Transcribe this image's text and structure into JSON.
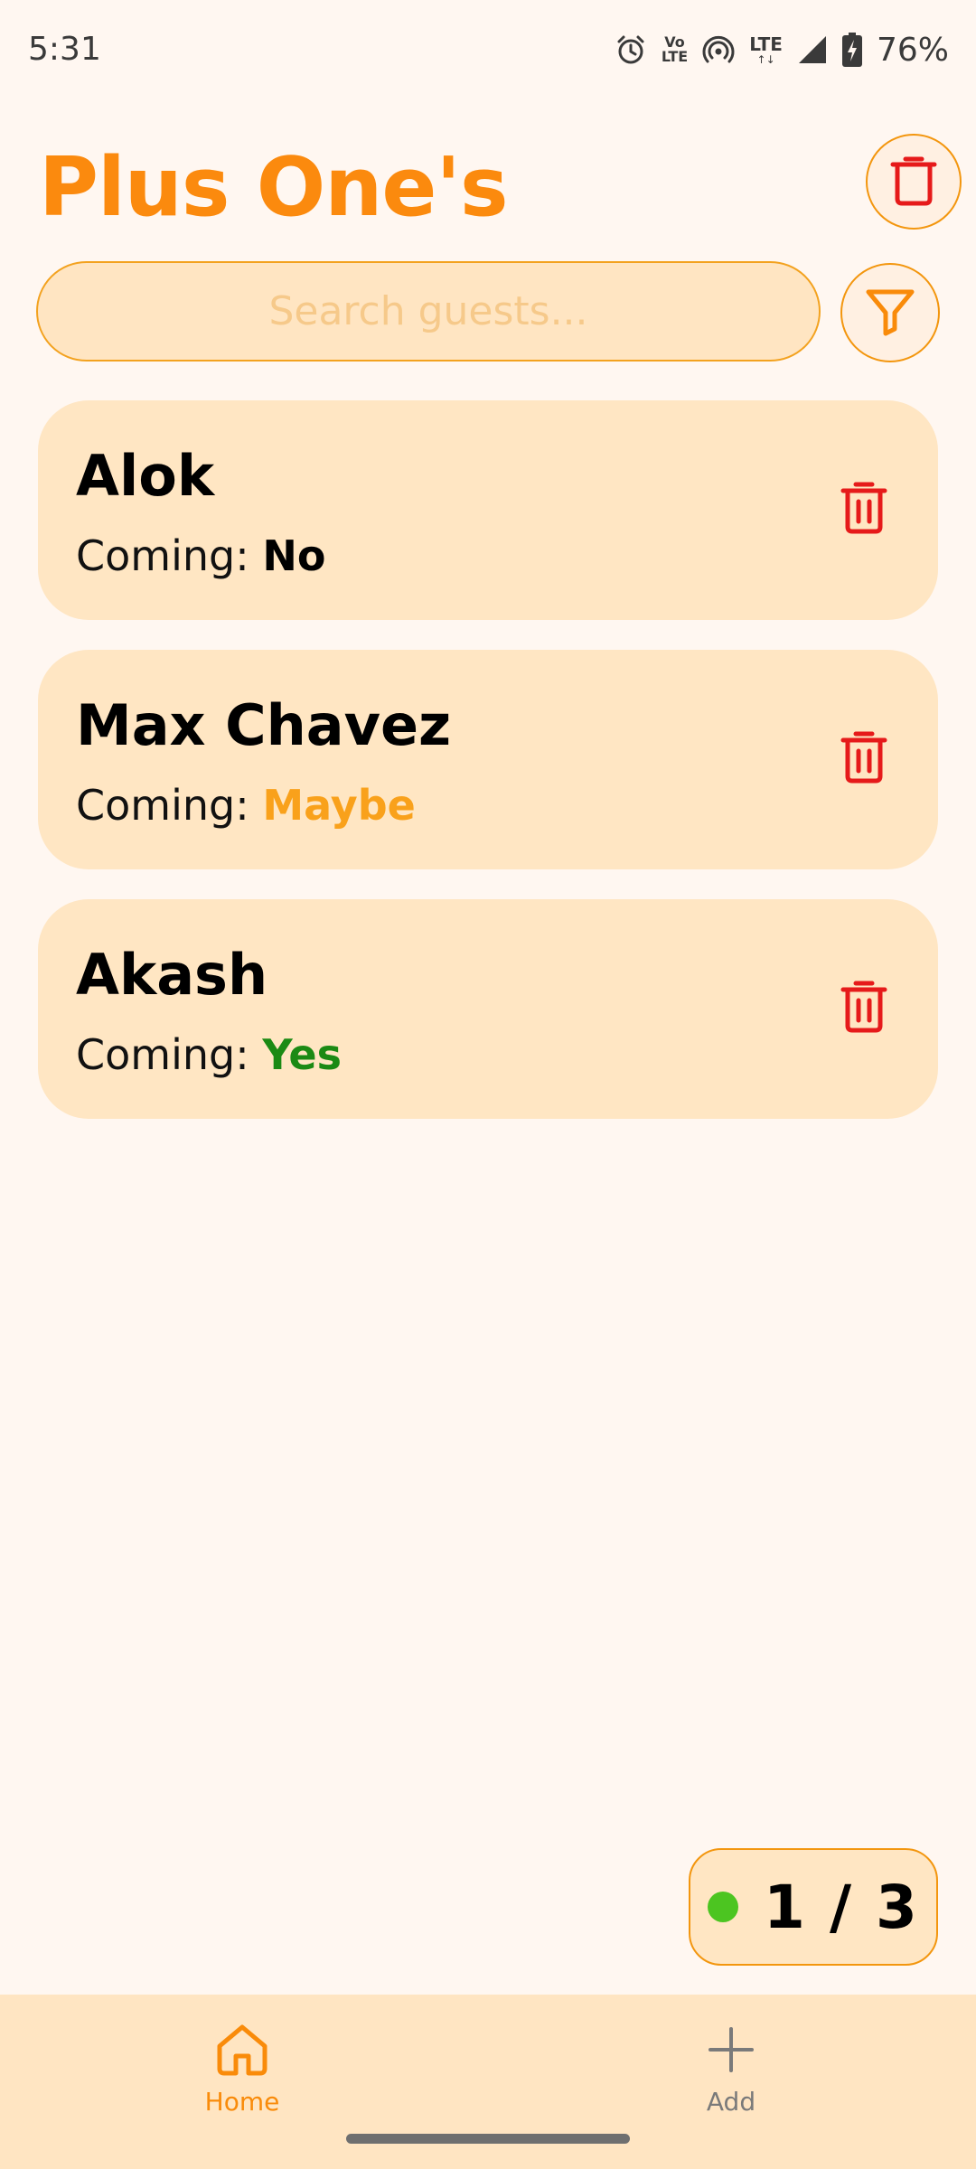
{
  "status_bar": {
    "time": "5:31",
    "volte_top": "Vo",
    "volte_bottom": "LTE",
    "lte_label": "LTE",
    "battery": "76%",
    "icons": [
      "alarm-icon",
      "volte-icon",
      "hotspot-icon",
      "lte-icon",
      "signal-icon",
      "battery-charging-icon"
    ]
  },
  "header": {
    "title": "Plus One's",
    "delete_all_icon": "trash-icon"
  },
  "search": {
    "placeholder": "Search guests...",
    "value": "",
    "filter_icon": "filter-icon"
  },
  "guests": [
    {
      "name": "Alok",
      "status_label": "Coming:",
      "status": "No",
      "status_color": "#000000"
    },
    {
      "name": "Max Chavez",
      "status_label": "Coming:",
      "status": "Maybe",
      "status_color": "#F9A11B"
    },
    {
      "name": "Akash",
      "status_label": "Coming:",
      "status": "Yes",
      "status_color": "#1B8A14"
    }
  ],
  "counter": {
    "text": "1 / 3",
    "dot_color": "#4CC521"
  },
  "nav": {
    "home_label": "Home",
    "add_label": "Add"
  },
  "colors": {
    "accent": "#FB8A0E",
    "card": "#FFE6C3",
    "background": "#FFF7F1",
    "delete": "#E61A1A"
  }
}
